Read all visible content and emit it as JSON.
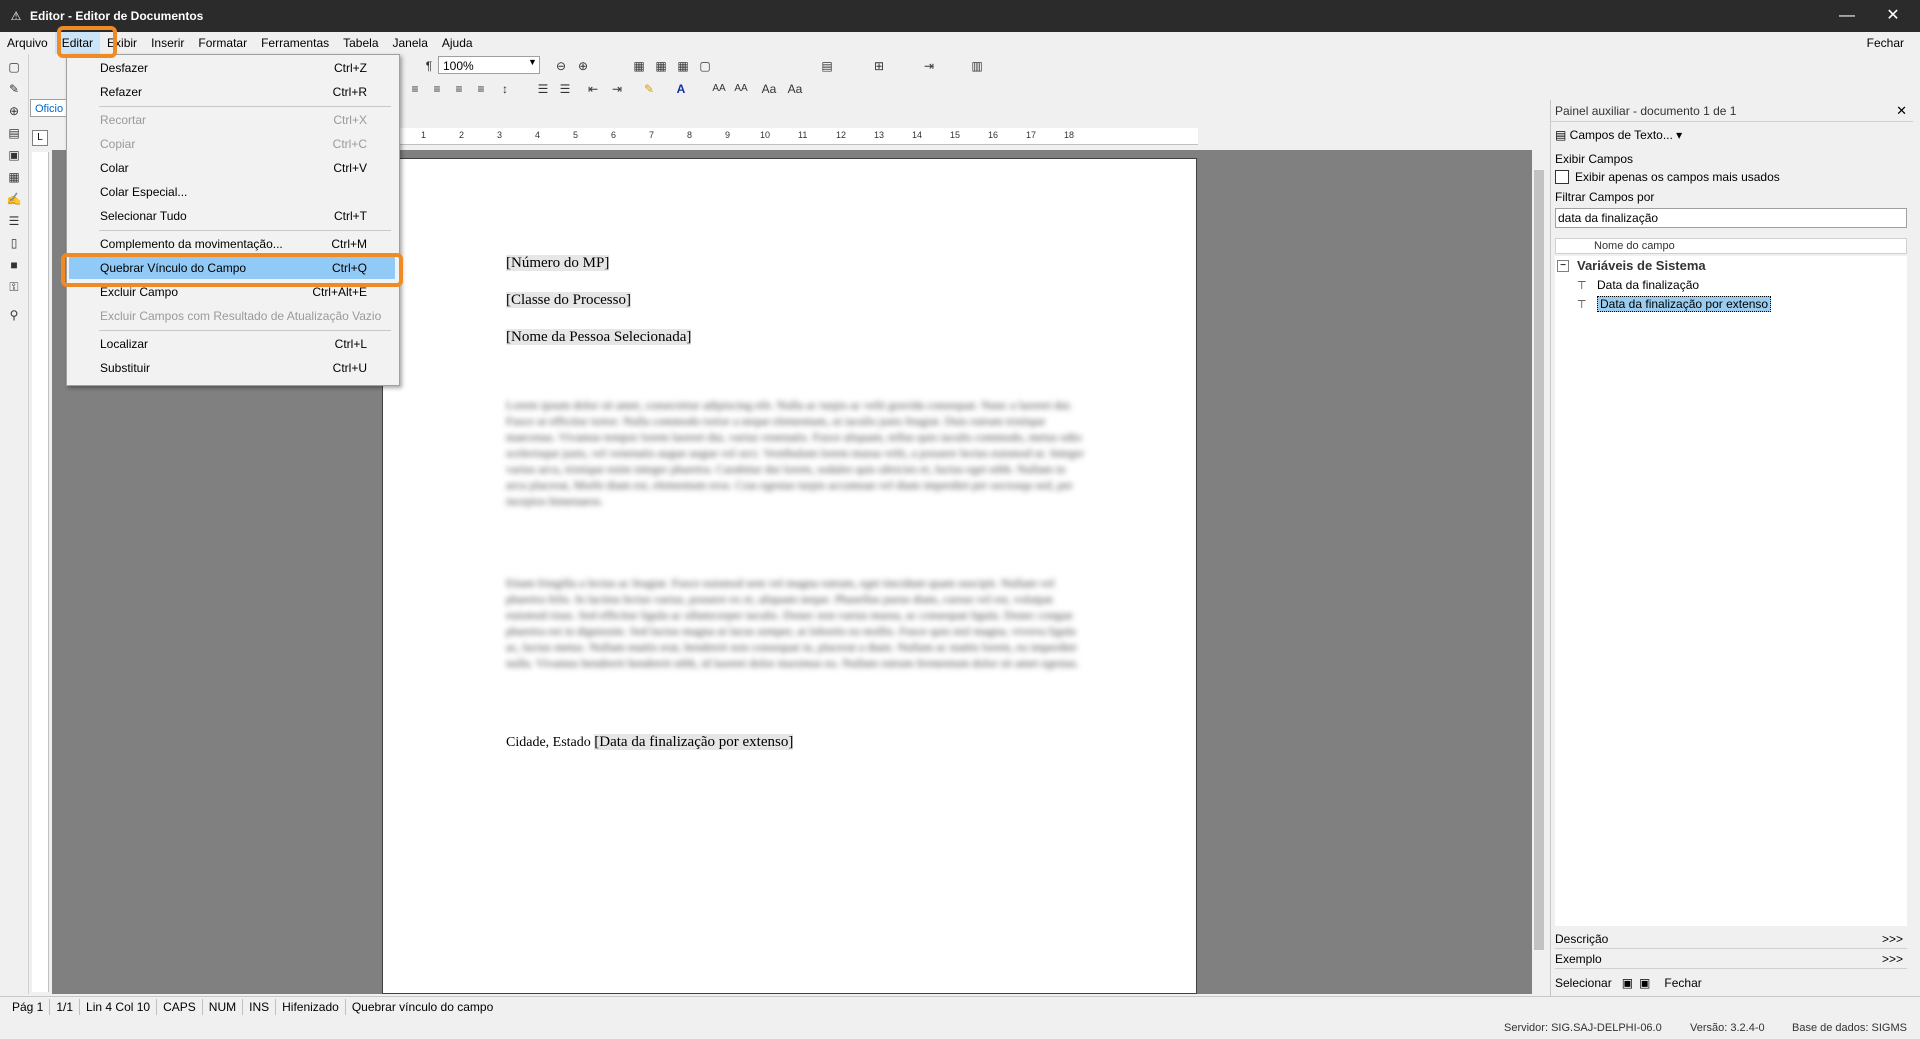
{
  "window": {
    "title": "Editor - Editor de Documentos",
    "minimize": "—",
    "maximize": "☐",
    "close": "✕"
  },
  "menubar": {
    "items": [
      "Arquivo",
      "Editar",
      "Exibir",
      "Inserir",
      "Formatar",
      "Ferramentas",
      "Tabela",
      "Janela",
      "Ajuda"
    ],
    "active": "Editar",
    "fechar": "Fechar"
  },
  "toolbar": {
    "zoom_value": "100%",
    "style_value": "Oficio"
  },
  "edit_menu": {
    "items": [
      {
        "label": "Desfazer",
        "shortcut": "Ctrl+Z",
        "enabled": true
      },
      {
        "label": "Refazer",
        "shortcut": "Ctrl+R",
        "enabled": true
      },
      {
        "label": "Recortar",
        "shortcut": "Ctrl+X",
        "enabled": false
      },
      {
        "label": "Copiar",
        "shortcut": "Ctrl+C",
        "enabled": false
      },
      {
        "label": "Colar",
        "shortcut": "Ctrl+V",
        "enabled": true
      },
      {
        "label": "Colar Especial...",
        "shortcut": "",
        "enabled": true
      },
      {
        "label": "Selecionar Tudo",
        "shortcut": "Ctrl+T",
        "enabled": true
      },
      {
        "label": "Complemento da movimentação...",
        "shortcut": "Ctrl+M",
        "enabled": true
      },
      {
        "label": "Quebrar Vínculo do Campo",
        "shortcut": "Ctrl+Q",
        "enabled": true,
        "highlighted": true
      },
      {
        "label": "Excluir Campo",
        "shortcut": "Ctrl+Alt+E",
        "enabled": true
      },
      {
        "label": "Excluir Campos com Resultado de Atualização Vazio",
        "shortcut": "",
        "enabled": false
      },
      {
        "label": "Localizar",
        "shortcut": "Ctrl+L",
        "enabled": true
      },
      {
        "label": "Substituir",
        "shortcut": "Ctrl+U",
        "enabled": true
      }
    ]
  },
  "ruler": {
    "ticks": [
      "1",
      "2",
      "3",
      "4",
      "5",
      "6",
      "7",
      "8",
      "9",
      "10",
      "11",
      "12",
      "13",
      "14",
      "15",
      "16",
      "17",
      "18"
    ]
  },
  "document": {
    "fields": [
      "[Número do MP]",
      "[Classe do Processo]",
      "[Nome da Pessoa Selecionada]"
    ],
    "blurred_paragraph_1": "Lorem ipsum dolor sit amet, consectetur adipiscing elit. Nulla ac turpis ac velit gravida consequat. Nunc a laoreet dui. Fusce ut efficitur tortor. Nulla commodo tortor a neque elementum, ut iaculis justo feugiat. Duis rutrum tristique maecenas. Vivamus tempor lorem laoreet dui, varius venenatis. Fusce aliquam, tellus quis iaculis commodo, metus odio scelerisque justo, vel venenatis augue augue vel orci. Vestibulum lorem massa velit, a posuere lectus euismod ut. Integer varius arcu, tristique enim integer pharetra. Curabitur dui lorem, sodales quis ultricies et, luctus eget nibh. Nullam in arcu placerat, Morbi diam est, elementum eros. Cras egestas turpis accumsan vel diam imperdiet per sociosqu sed, per inceptos himenaeos.",
    "blurred_paragraph_2": "Etiam fringilla a lectus ac feugiat. Fusce euismod sem vel magna rutrum, eget tincidunt quam suscipit. Nullam vel pharetra felis. In lacinia lectus varius, posuere ex et, aliquam neque. Phasellus purus diam, cursus vel est, volutpat euismod risus. Sed efficitur ligula ac ullamcorper iaculis. Donec non varius massa, ac consequat ligula. Donec congue pharetra est in dignissim. Sed luctus magna ut lacus semper, at lobortis eu mollis. Fusce quis nisl magna, viverra ligula ac, luctus metus. Nullam mattis erat, hendrerit non consequat in, placerat a diam. Nullam ac mattis lorem, eu imperdiet nulla. Vivamus hendrerit hendrerit nibh, id laoreet dolor maximus eu. Nullam rutrum fermentum dolor sit amet egestas.",
    "closing_prefix": "Cidade, Estado ",
    "closing_field": "[Data da finalização por extenso]"
  },
  "right_panel": {
    "title": "Painel auxiliar - documento 1 de 1",
    "campos_dropdown": "Campos de Texto...",
    "exibir_campos_label": "Exibir Campos",
    "checkbox_label": "Exibir apenas os campos mais usados",
    "filtrar_label": "Filtrar Campos por",
    "filter_value": "data da finalização",
    "column_header": "Nome do campo",
    "tree_group": "Variáveis de Sistema",
    "tree_items": [
      "Data da finalização",
      "Data da finalização por extenso"
    ],
    "selected_item": "Data da finalização por extenso",
    "descricao": "Descrição",
    "exemplo": "Exemplo",
    "more": ">>>",
    "selecionar": "Selecionar",
    "fechar": "Fechar"
  },
  "statusbar": {
    "page": "Pág 1",
    "pages": "1/1",
    "position": "Lin 4  Col 10",
    "caps": "CAPS",
    "num": "NUM",
    "ins": "INS",
    "hifenizado": "Hifenizado",
    "message": "Quebrar vínculo do campo"
  },
  "bottombar": {
    "servidor": "Servidor: SIG.SAJ-DELPHI-06.0",
    "versao": "Versão: 3.2.4-0",
    "base": "Base de dados: SIGMS"
  },
  "colors": {
    "highlight_ring": "#f08a24",
    "menu_highlight": "#91c9f7",
    "titlebar": "#2b2b2b"
  }
}
